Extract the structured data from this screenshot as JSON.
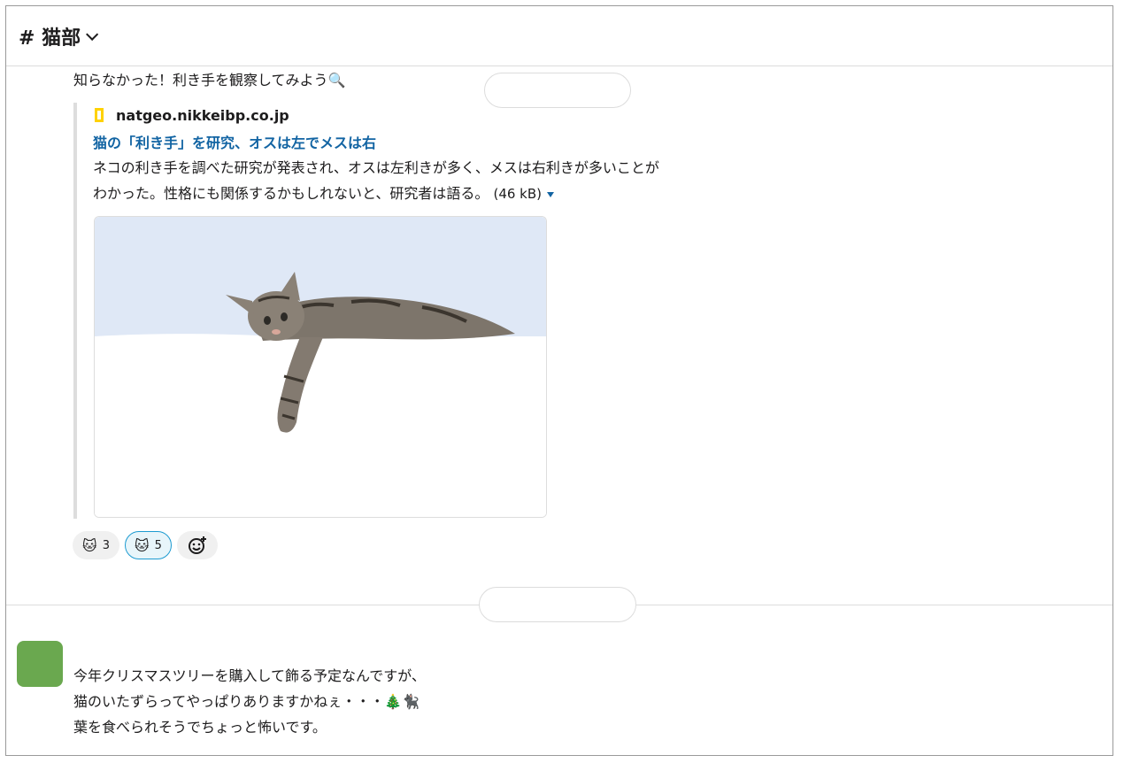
{
  "header": {
    "channel": "# 猫部"
  },
  "message1": {
    "text": "知らなかった！利き手を観察してみよう🔍"
  },
  "attachment": {
    "site": "natgeo.nikkeibp.co.jp",
    "title": "猫の「利き手」を研究、オスは左でメスは右",
    "description_line1": "ネコの利き手を調べた研究が発表され、オスは左利きが多く、メスは右利きが多いことが",
    "description_line2": "わかった。性格にも関係するかもしれないと、研究者は語る。",
    "size": "(46 kB)"
  },
  "reactions": [
    {
      "emoji": "🐱",
      "count": "3",
      "active": false
    },
    {
      "emoji": "🐱",
      "count": "5",
      "active": true
    }
  ],
  "message2": {
    "line1": "今年クリスマスツリーを購入して飾る予定なんですが、",
    "line2": "猫のいたずらってやっぱりありますかねぇ・・・🎄🐈‍⬛",
    "line3": "葉を食べられそうでちょっと怖いです。"
  },
  "colors": {
    "link": "#1264a3",
    "avatar": "#6aa84f",
    "site_logo": "#ffd200"
  }
}
